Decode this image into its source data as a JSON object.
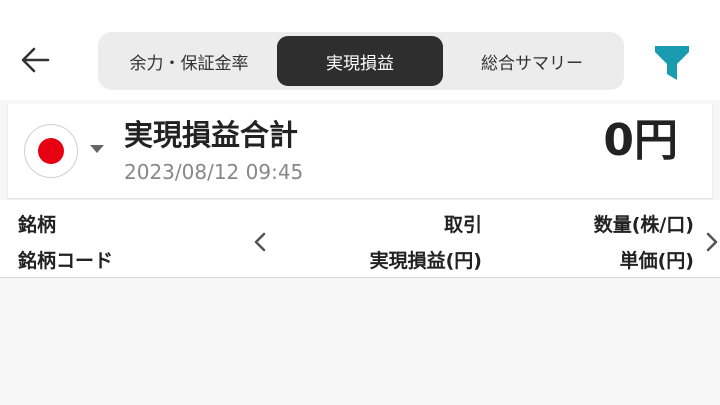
{
  "tabs": [
    {
      "label": "余力・保証金率"
    },
    {
      "label": "実現損益",
      "selected": true
    },
    {
      "label": "総合サマリー"
    }
  ],
  "icons": {
    "back": "arrow-left-icon",
    "filter": "funnel-icon",
    "market": "japan-flag-icon",
    "market_dropdown": "caret-down-icon",
    "prev": "chevron-left-icon",
    "next": "chevron-right-icon"
  },
  "colors": {
    "accent": "#1a9bb0",
    "selected_tab": "#2e2e2e",
    "flag_red": "#e60012"
  },
  "summary": {
    "title": "実現損益合計",
    "timestamp": "2023/08/12 09:45",
    "value": "0円"
  },
  "columns": {
    "left": [
      "銘柄",
      "銘柄コード"
    ],
    "middle": [
      "取引",
      "実現損益(円)"
    ],
    "right": [
      "数量(株/口)",
      "単価(円)"
    ]
  },
  "rows": []
}
